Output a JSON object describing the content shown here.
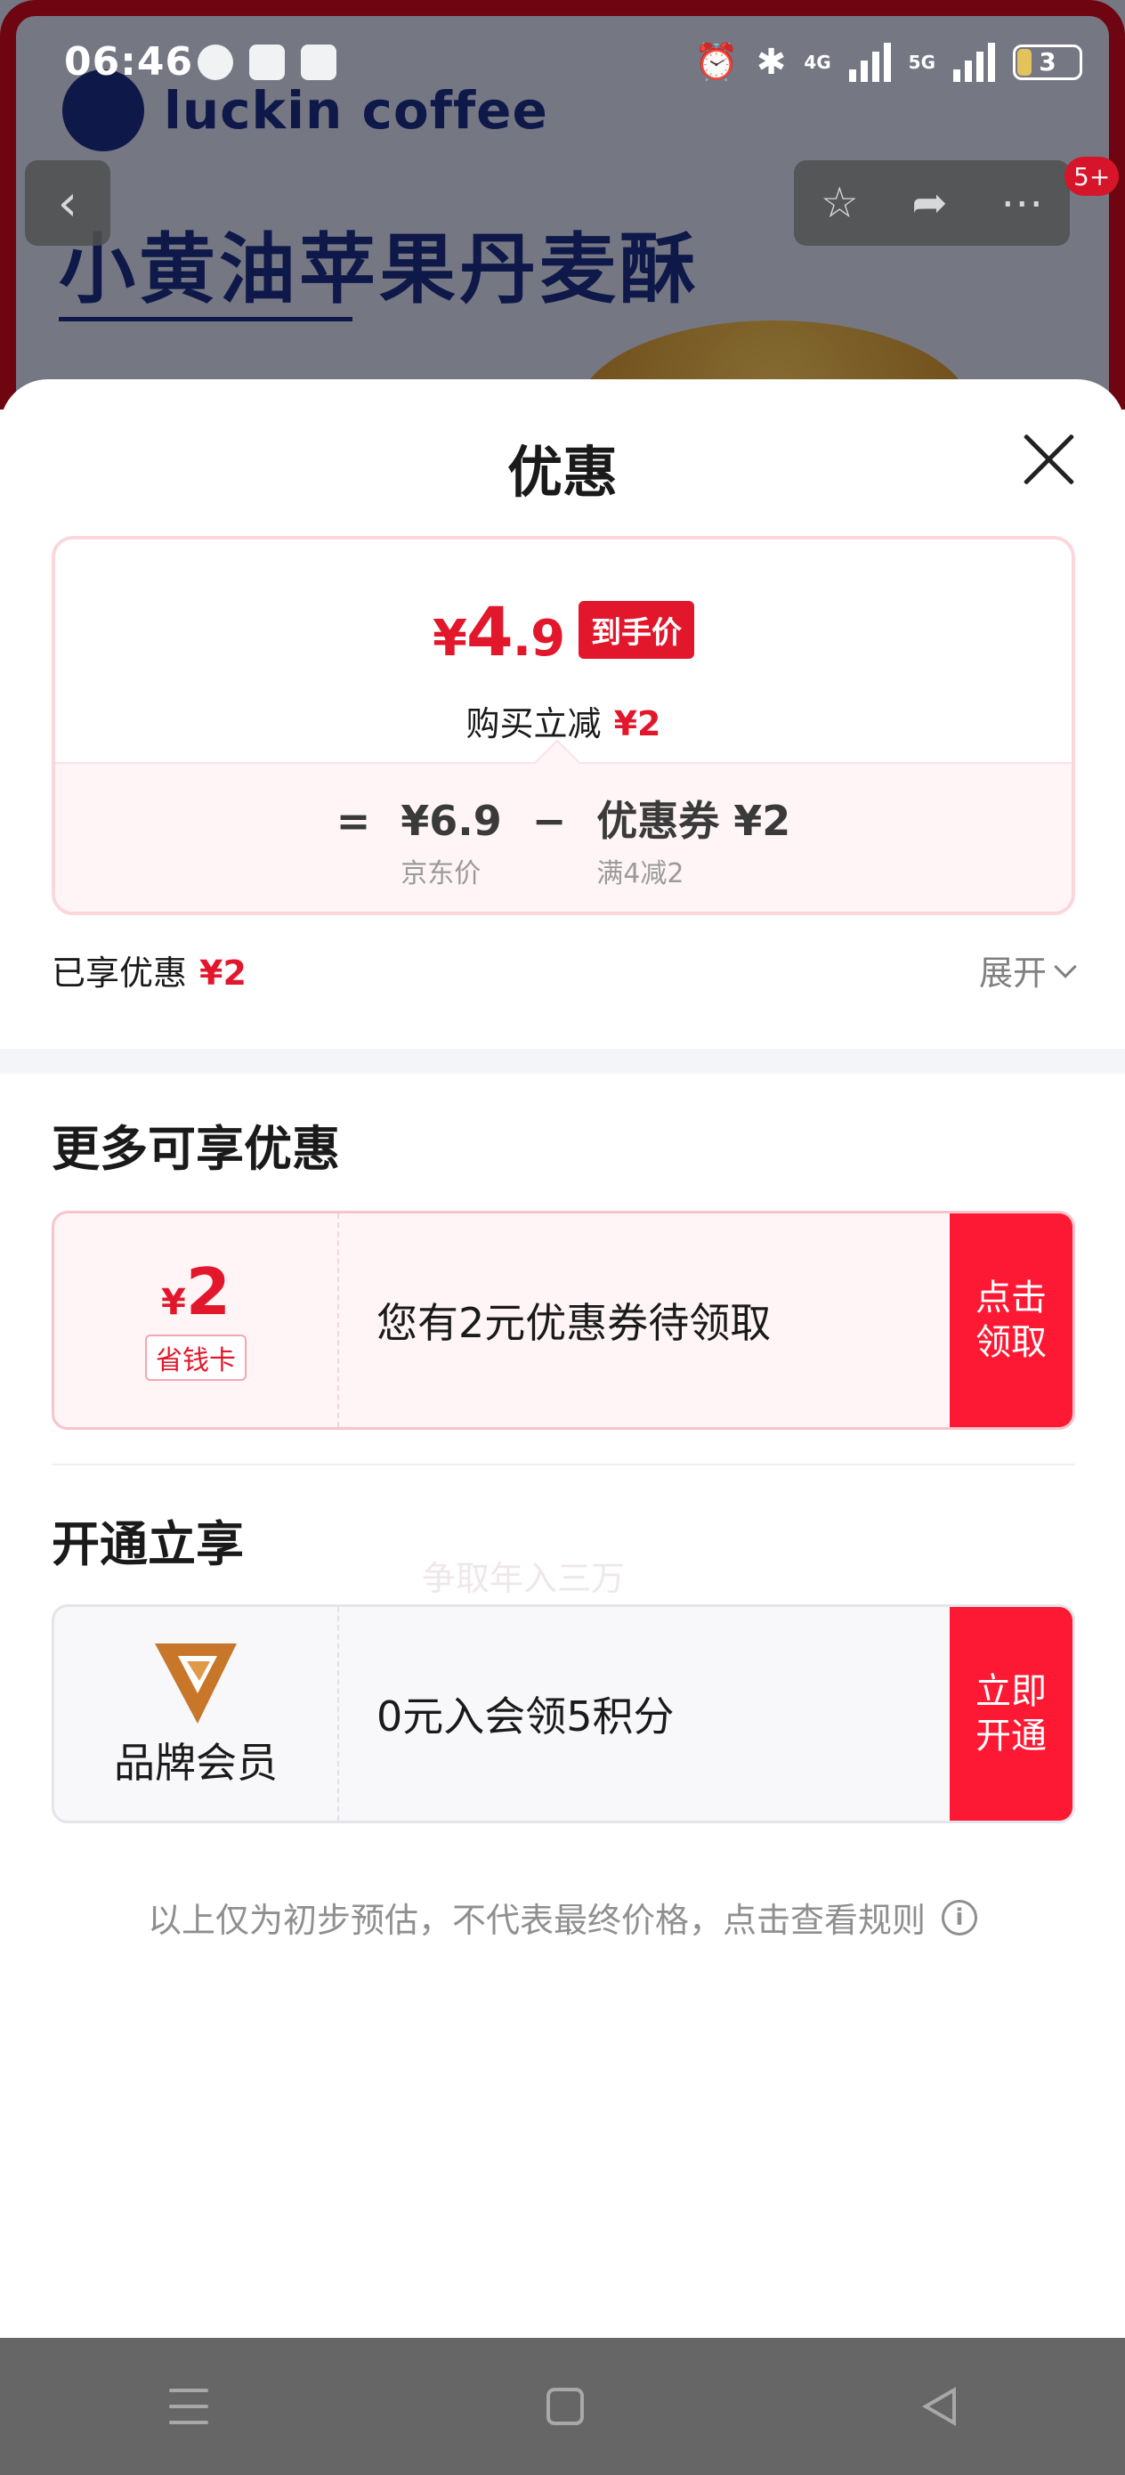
{
  "status_bar": {
    "time": "06:46",
    "net1": "4G",
    "net2": "5G",
    "battery": "3"
  },
  "background": {
    "brand": "luckin coffee",
    "product_title": "小黄油苹果丹麦酥",
    "badge": "5+"
  },
  "sheet": {
    "title": "优惠",
    "price": {
      "symbol": "¥",
      "integer": "4",
      "decimal": ".9",
      "tag": "到手价"
    },
    "reduce": {
      "label": "购买立减",
      "amount": "¥2"
    },
    "formula": {
      "equals": "=",
      "minus": "−",
      "jd_price": "¥6.9",
      "jd_label": "京东价",
      "coupon_value": "优惠券 ¥2",
      "coupon_condition": "满4减2"
    },
    "enjoyed": {
      "label": "已享优惠",
      "amount": "¥2"
    },
    "expand_label": "展开",
    "more_title": "更多可享优惠",
    "watermark": "争取年入三万",
    "coupon_offer": {
      "yen": "¥",
      "amount": "2",
      "card_label": "省钱卡",
      "description": "您有2元优惠券待领取",
      "cta": "点击领取"
    },
    "member_title": "开通立享",
    "member_offer": {
      "label": "品牌会员",
      "description": "0元入会领5积分",
      "cta": "立即开通"
    },
    "footnote": "以上仅为初步预估，不代表最终价格，点击查看规则",
    "info_icon_glyph": "i"
  },
  "colors": {
    "accent_red": "#e3172b",
    "cta_red": "#fd1933",
    "brand_orange": "#c8762a"
  }
}
